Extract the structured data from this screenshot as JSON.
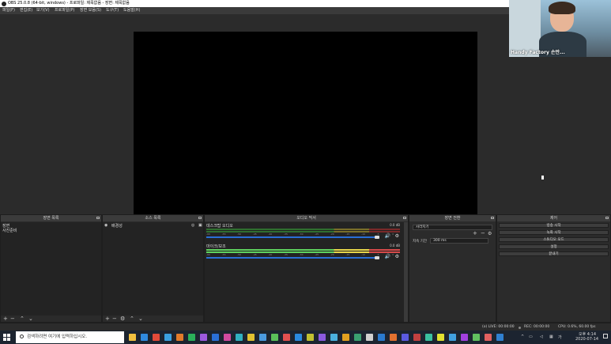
{
  "window": {
    "title": "OBS 25.0.8 (64-bit, windows) - 프로파일: 제목없음 - 장면: 제목없음"
  },
  "menu": [
    "파일(F)",
    "편집(E)",
    "보기(V)",
    "프로파일(P)",
    "장면 모음(S)",
    "도구(T)",
    "도움말(H)"
  ],
  "webcam": {
    "caption": "Handy Factory 손만..."
  },
  "docks": {
    "scenes": {
      "title": "장면 목록",
      "items": [
        "장면",
        "사진준비"
      ]
    },
    "sources": {
      "title": "소스 목록",
      "items": [
        "배경성"
      ]
    },
    "mixer": {
      "title": "오디오 믹서",
      "channels": [
        {
          "name": "데스크탑 오디오",
          "db": "0.0 dB"
        },
        {
          "name": "마이크/보조",
          "db": "0.0 dB"
        }
      ],
      "ticks": [
        "-60",
        "-55",
        "-50",
        "-45",
        "-40",
        "-35",
        "-30",
        "-25",
        "-20",
        "-15",
        "-10",
        "-5",
        "0"
      ]
    },
    "transitions": {
      "title": "장면 전환",
      "selected": "사라지기",
      "duration_label": "지속 기간",
      "duration_value": "300 ms"
    },
    "controls": {
      "title": "제어",
      "buttons": [
        "방송 시작",
        "녹화 시작",
        "스튜디오 모드",
        "설정",
        "끝내기"
      ]
    }
  },
  "status": {
    "live": "(o) LIVE: 00:00:00",
    "rec": "REC: 00:00:00",
    "cpu": "CPU: 0.6%, 60.00 fps"
  },
  "taskbar": {
    "search_placeholder": "검색하려면 여기에 입력하십시오.",
    "time": "오후 4:14",
    "date": "2020-07-14",
    "apps": [
      "#f0c040",
      "#2f8ae0",
      "#e04a3a",
      "#3aa0e0",
      "#e07a2a",
      "#2ab05a",
      "#9a5ae0",
      "#2a6fd6",
      "#d04aa0",
      "#30b0c0",
      "#e0c030",
      "#4a9ae0",
      "#5ac05a",
      "#e05050",
      "#2a8ae0",
      "#c0c030",
      "#8a5ae0",
      "#4ab0e0",
      "#e0a020",
      "#3aa070",
      "#d0d0d0",
      "#2a7ad0",
      "#e07030",
      "#5a5ae0",
      "#c04040",
      "#3ac0a0",
      "#e0e030",
      "#40a0e0",
      "#a040e0",
      "#60c060",
      "#e06060",
      "#3080d0"
    ]
  },
  "colors": {
    "meter_green": "#5fd35f",
    "meter_yellow": "#e8d64a",
    "meter_red": "#d64a4a",
    "slider_blue": "#2a6fd6"
  }
}
